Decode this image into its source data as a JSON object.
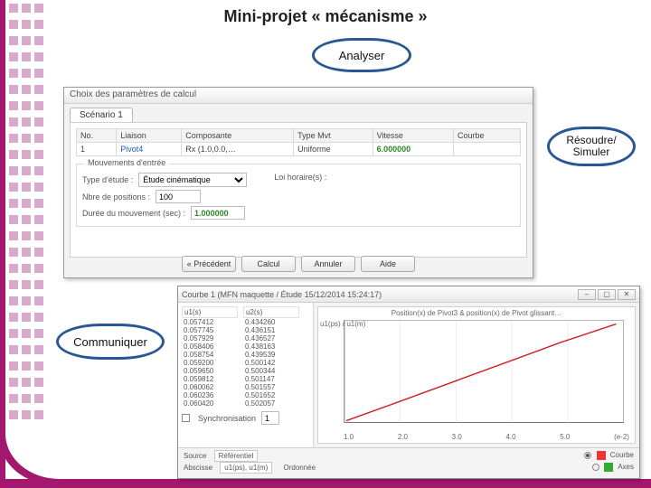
{
  "title": "Mini-projet « mécanisme »",
  "bubbles": {
    "analyser": "Analyser",
    "resoudre": "Résoudre/\nSimuler",
    "communiquer": "Communiquer"
  },
  "dlg1": {
    "caption": "Choix des paramètres de calcul",
    "tab": "Scénario 1",
    "columns": [
      "No.",
      "Liaison",
      "Composante",
      "Type Mvt",
      "Vitesse",
      "Courbe"
    ],
    "row": {
      "no": "1",
      "liaison": "Pivot4",
      "composante": "Rx (1.0,0.0,…",
      "type": "Uniforme",
      "vitesse": "6.000000",
      "courbe": ""
    },
    "group_label": "Mouvements d'entrée",
    "type_etude_label": "Type d'étude :",
    "type_etude_value": "Étude cinématique",
    "nb_pos_label": "Nbre de positions :",
    "nb_pos_value": "100",
    "duree_label": "Durée du mouvement (sec) :",
    "duree_value": "1.000000",
    "loi_label": "Loi horaire(s) :",
    "buttons": {
      "prev": "« Précédent",
      "calcul": "Calcul",
      "annuler": "Annuler",
      "aide": "Aide"
    }
  },
  "dlg2": {
    "caption": "Courbe 1 (MFN maquette / Étude 15/12/2014  15:24:17)",
    "col_headers": [
      "u1(s)",
      "u2(s)"
    ],
    "rows": [
      [
        "0.057412",
        "0.434260"
      ],
      [
        "0.057745",
        "0.436151"
      ],
      [
        "0.057929",
        "0.436527"
      ],
      [
        "0.058406",
        "0.438163"
      ],
      [
        "0.058754",
        "0.439539"
      ],
      [
        "0.059200",
        "0.500142"
      ],
      [
        "0.059650",
        "0.500344"
      ],
      [
        "0.059812",
        "0.501147"
      ],
      [
        "0.060062",
        "0.501557"
      ],
      [
        "0.060236",
        "0.501652"
      ],
      [
        "0.060420",
        "0.502057"
      ]
    ],
    "sync_label": "Synchronisation",
    "sync_field": "1",
    "src_label": "Source",
    "src_value": "Référentiel",
    "abs_label": "Abscisse",
    "abs_value": "u1(ps), u1(m)",
    "ord_label": "Ordonnée",
    "radio_curve": "Courbe",
    "radio_axes": "Axes",
    "plot_title": "Position(x) de Pivot3 & position(x) de Pivot glissant…",
    "ylabel": "u1(ps) / u1(m)",
    "xticks": [
      "1.0",
      "2.0",
      "3.0",
      "4.0",
      "5.0",
      "(e-2)"
    ]
  },
  "chart_data": {
    "type": "line",
    "title": "Position(x) de Pivot3 & position(x) de Pivot glissant…",
    "xlabel": "",
    "ylabel": "u1(ps) / u1(m)",
    "xlim": [
      0,
      0.06
    ],
    "ylim": [
      0,
      0.5
    ],
    "series": [
      {
        "name": "u1",
        "color": "#cc2222",
        "x": [
          0.005,
          0.015,
          0.025,
          0.035,
          0.045,
          0.055
        ],
        "y": [
          0.04,
          0.13,
          0.22,
          0.31,
          0.4,
          0.49
        ]
      }
    ],
    "xticks": [
      0.01,
      0.02,
      0.03,
      0.04,
      0.05
    ]
  }
}
